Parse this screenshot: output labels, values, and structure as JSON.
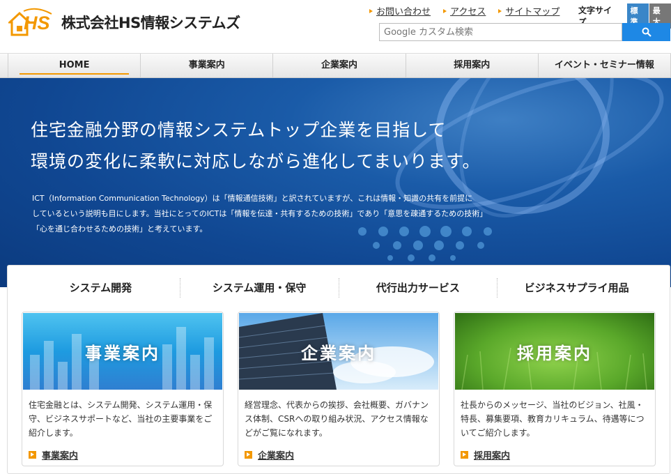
{
  "logo": {
    "mark_text": "HS",
    "company_name": "株式会社HS情報システムズ"
  },
  "top_links": [
    {
      "label": "お問い合わせ"
    },
    {
      "label": "アクセス"
    },
    {
      "label": "サイトマップ"
    }
  ],
  "font_size": {
    "label": "文字サイズ",
    "standard": "標準",
    "max": "最大",
    "selected": "標準"
  },
  "search": {
    "placeholder": "Google カスタム検索",
    "button_icon": "search-icon"
  },
  "nav": [
    {
      "label": "HOME",
      "active": true
    },
    {
      "label": "事業案内"
    },
    {
      "label": "企業案内"
    },
    {
      "label": "採用案内"
    },
    {
      "label": "イベント・セミナー情報"
    }
  ],
  "hero": {
    "title_line1": "住宅金融分野の情報システムトップ企業を目指して",
    "title_line2": "環境の変化に柔軟に対応しながら進化してまいります。",
    "text_line1": "ICT（Information Communication Technology）は「情報通信技術」と訳されていますが、これは情報・知識の共有を前提に",
    "text_line2": "しているという説明も目にします。当社にとってのICTは「情報を伝達・共有するための技術」であり「意思を疎通するための技術」",
    "text_line3": "「心を通じ合わせるための技術」と考えています。"
  },
  "services": [
    {
      "label": "システム開発"
    },
    {
      "label": "システム運用・保守"
    },
    {
      "label": "代行出力サービス"
    },
    {
      "label": "ビジネスサプライ用品"
    }
  ],
  "cards": [
    {
      "image_label": "事業案内",
      "text": "住宅金融とは、システム開発、システム運用・保守、ビジネスサポートなど、当社の主要事業をご紹介します。",
      "link": "事業案内"
    },
    {
      "image_label": "企業案内",
      "text": "経営理念、代表からの挨拶、会社概要、ガバナンス体制、CSRへの取り組み状況、アクセス情報などがご覧になれます。",
      "link": "企業案内"
    },
    {
      "image_label": "採用案内",
      "text": "社長からのメッセージ、当社のビジョン、社風・特長、募集要項、教育カリキュラム、待遇等についてご紹介します。",
      "link": "採用案内"
    }
  ],
  "colors": {
    "accent": "#f39800",
    "brand_blue": "#1e88e5",
    "hero_blue": "#104792"
  }
}
